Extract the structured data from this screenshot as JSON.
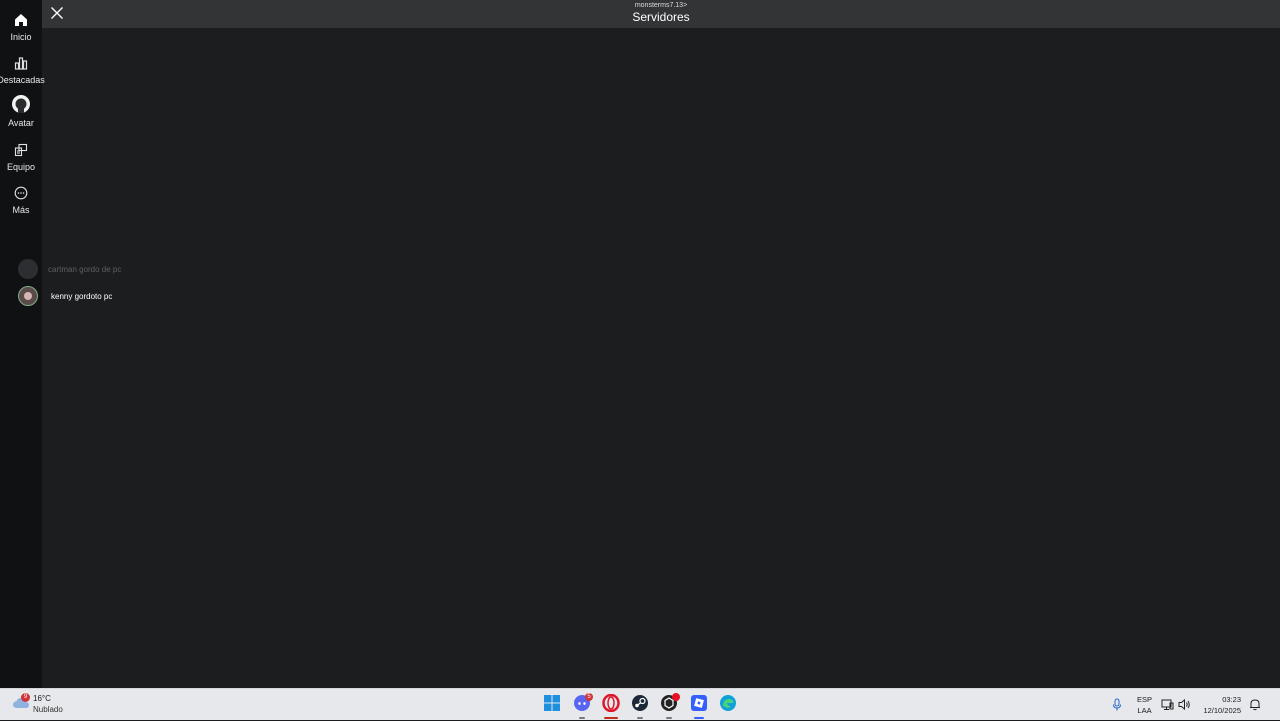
{
  "sidebar": {
    "items": [
      {
        "label": "Inicio",
        "icon": "home-icon"
      },
      {
        "label": "Destacadas",
        "icon": "charts-icon"
      },
      {
        "label": "Avatar",
        "icon": "avatar-icon"
      },
      {
        "label": "Equipo",
        "icon": "inventory-icon"
      },
      {
        "label": "Más",
        "icon": "more-icon"
      }
    ]
  },
  "header": {
    "subtitle": "monsterms7.13>",
    "title": "Servidores",
    "close_icon": "close-icon"
  },
  "players": [
    {
      "name": "cartman gordo de pc"
    },
    {
      "name": "kenny gordoto pc"
    }
  ],
  "taskbar": {
    "weather": {
      "temp": "16°C",
      "condition": "Nublado",
      "badge": "9"
    },
    "apps": [
      {
        "name": "start-button",
        "icon": "windows-icon"
      },
      {
        "name": "discord",
        "icon": "discord-icon",
        "badge": "5"
      },
      {
        "name": "opera",
        "icon": "opera-icon"
      },
      {
        "name": "steam",
        "icon": "steam-icon"
      },
      {
        "name": "unity",
        "icon": "unity-icon"
      },
      {
        "name": "roblox",
        "icon": "roblox-icon"
      },
      {
        "name": "edge",
        "icon": "edge-icon"
      }
    ],
    "language": {
      "line1": "ESP",
      "line2": "LAA"
    },
    "clock": {
      "time": "03:23",
      "date": "12/10/2025"
    }
  },
  "colors": {
    "background": "#1c1d1f",
    "sidebar": "#101113",
    "topbar": "#333436",
    "taskbar": "#e6e8ec",
    "accent_red": "#d13438"
  }
}
